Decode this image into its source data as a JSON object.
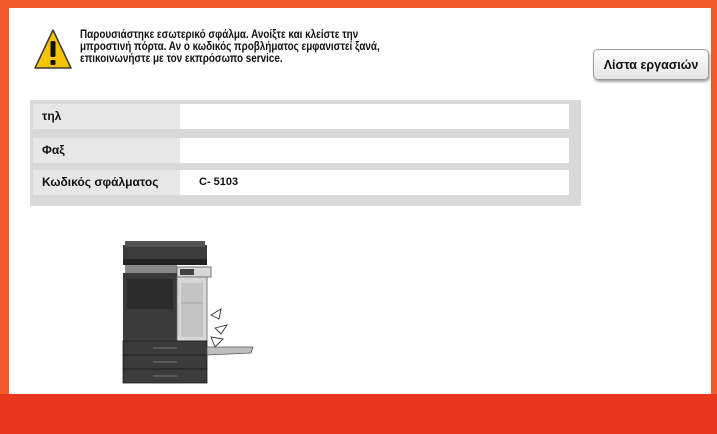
{
  "message": {
    "lines": [
      "Παρουσιάστηκε εσωτερικό σφάλμα. Ανοίξτε και κλείστε την",
      "μπροστινή πόρτα.  Αν ο κωδικός προβλήματος εμφανιστεί ξανά,",
      "επικοινωνήστε με τον εκπρόσωπο service."
    ]
  },
  "job_list_button": "Λίστα εργασιών",
  "info": {
    "rows": [
      {
        "label": "τηλ",
        "value": ""
      },
      {
        "label": "Φαξ",
        "value": ""
      },
      {
        "label": "Κωδικός σφάλματος",
        "value": "C-  5103"
      }
    ]
  },
  "colors": {
    "frame": "#f05a28",
    "bottom_bar": "#e8361c",
    "warning": "#f2c500"
  },
  "icons": {
    "warning": "warning-icon",
    "device": "printer-image"
  }
}
